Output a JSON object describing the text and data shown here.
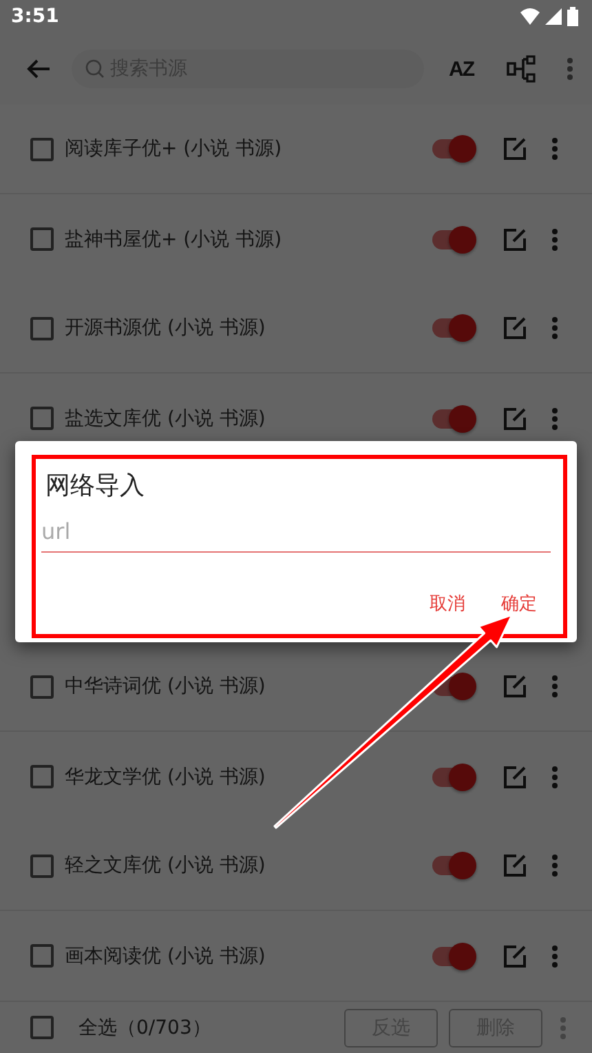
{
  "status_bar": {
    "time": "3:51"
  },
  "toolbar": {
    "search": {
      "placeholder": "搜索书源"
    },
    "sort_label": "AZ"
  },
  "sources_above_dialog": [
    {
      "name": "阅读库子优+ (小说 书源)",
      "checked": false,
      "enabled": true
    },
    {
      "name": "盐神书屋优+ (小说 书源)",
      "checked": false,
      "enabled": true
    },
    {
      "name": "开源书源优 (小说 书源)",
      "checked": false,
      "enabled": true
    },
    {
      "name": "盐选文库优 (小说 书源)",
      "checked": false,
      "enabled": true
    }
  ],
  "sources_below_dialog": [
    {
      "name": "中华诗词优 (小说 书源)",
      "checked": false,
      "enabled": true
    },
    {
      "name": "华龙文学优 (小说 书源)",
      "checked": false,
      "enabled": true
    },
    {
      "name": "轻之文库优 (小说 书源)",
      "checked": false,
      "enabled": true
    },
    {
      "name": "画本阅读优 (小说 书源)",
      "checked": false,
      "enabled": true
    }
  ],
  "bottom_bar": {
    "select_all": {
      "label": "全选（0/703）",
      "checked": false
    },
    "buttons": [
      {
        "label": "反选",
        "disabled": true
      },
      {
        "label": "删除",
        "disabled": true
      }
    ]
  },
  "dialog": {
    "title": "网络导入",
    "field": {
      "placeholder": "url"
    },
    "buttons": [
      {
        "label": "取消"
      },
      {
        "label": "确定"
      }
    ]
  }
}
